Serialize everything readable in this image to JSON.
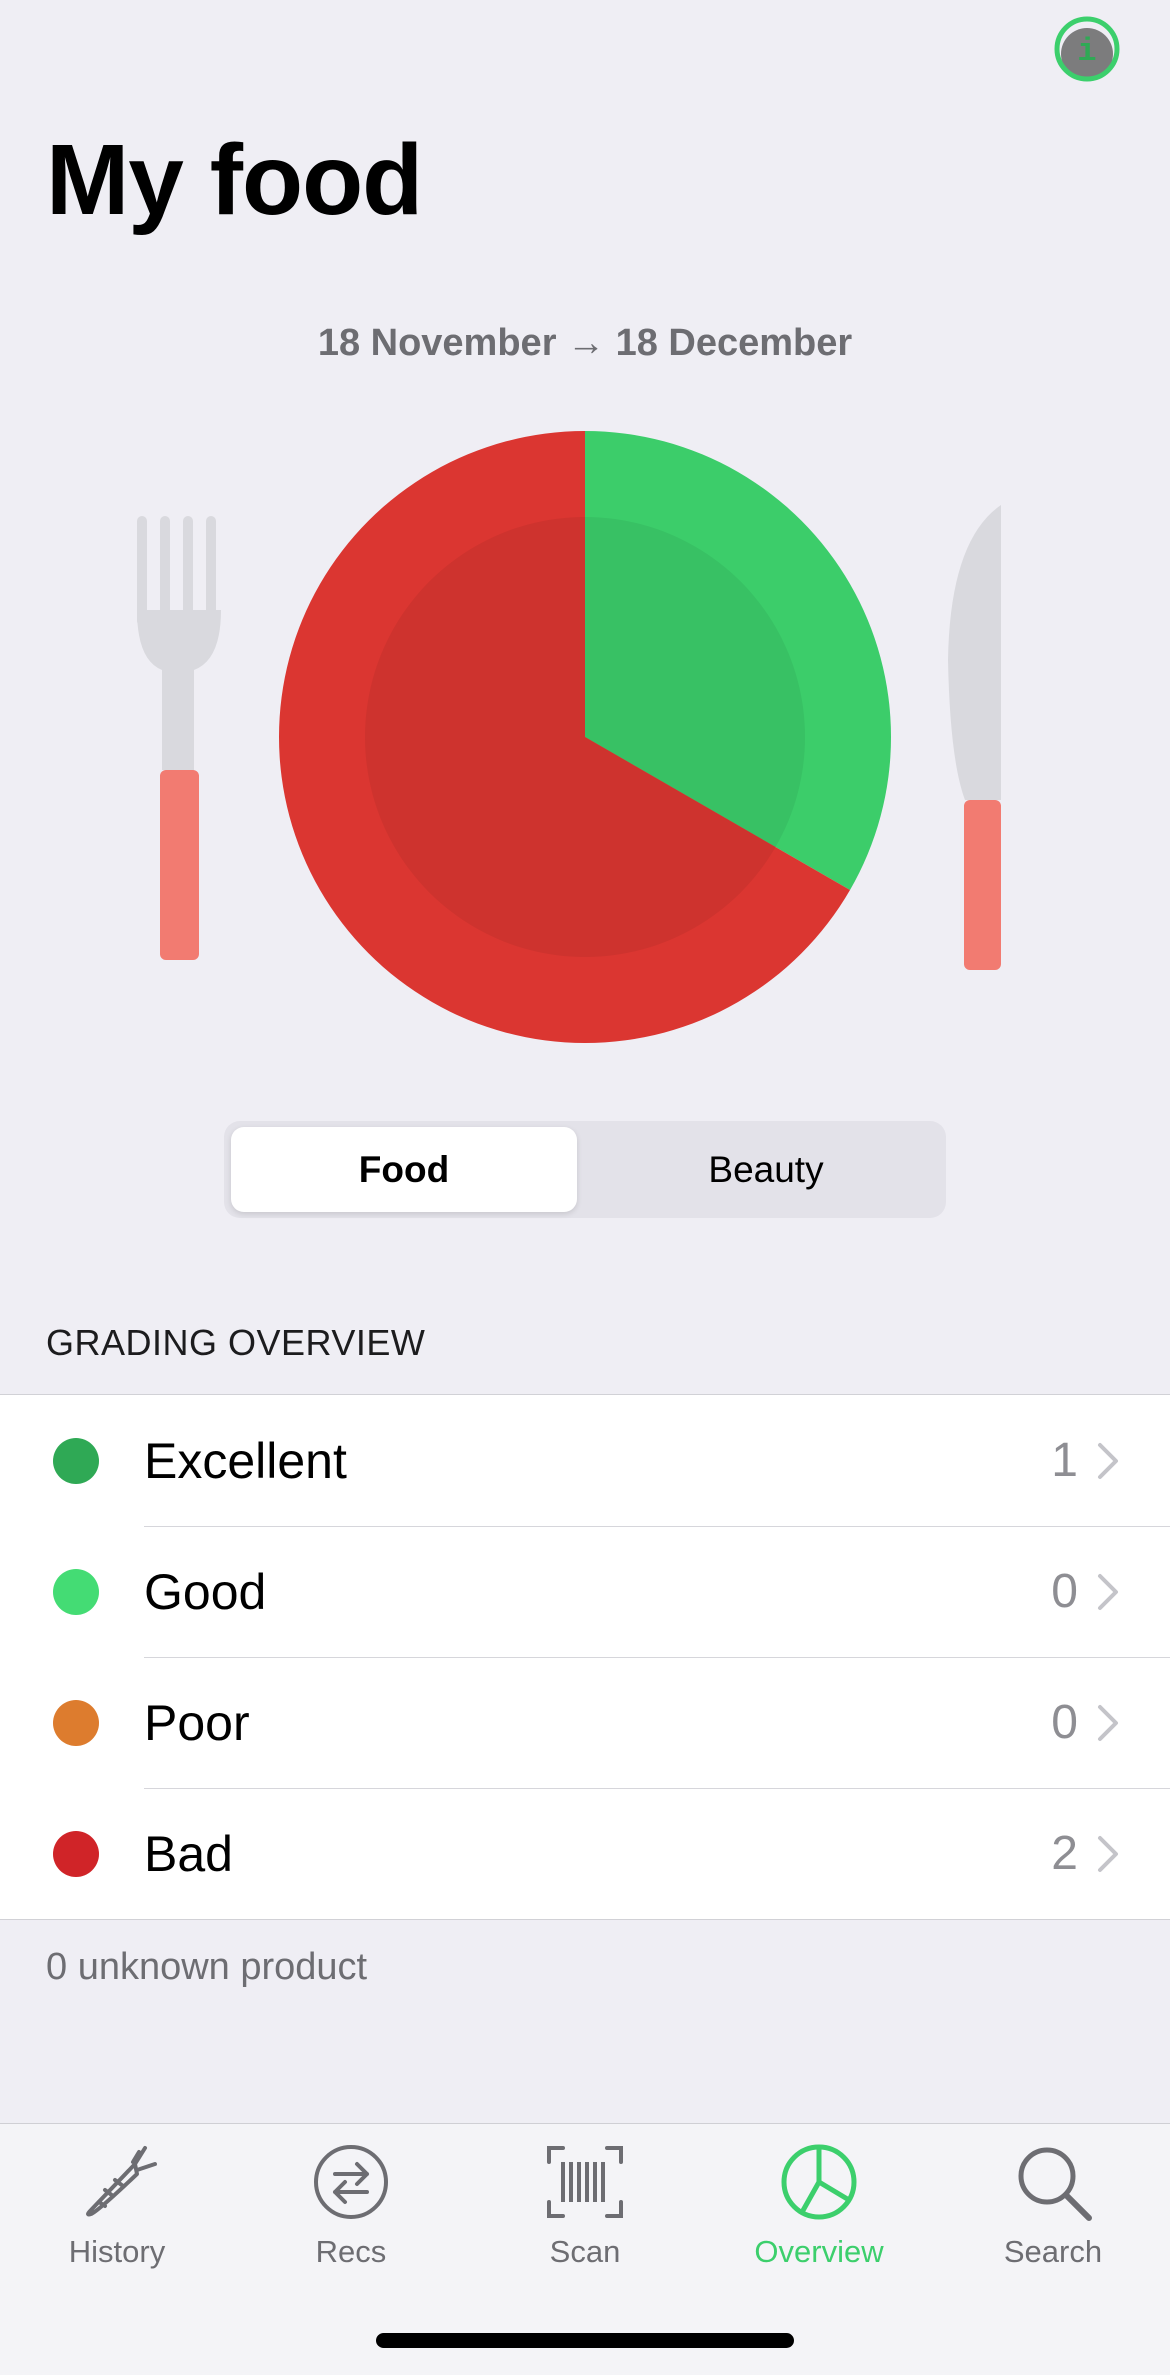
{
  "header": {
    "title": "My food",
    "info_icon": "info-icon"
  },
  "date_range": "18 November → 18 December",
  "chart_data": {
    "type": "pie",
    "title": "",
    "slices": [
      {
        "name": "Excellent",
        "value": 1,
        "color": "#3ccd6a"
      },
      {
        "name": "Bad",
        "value": 2,
        "color": "#db3631"
      }
    ]
  },
  "segmented_control": {
    "options": [
      "Food",
      "Beauty"
    ],
    "selected": "Food"
  },
  "grading": {
    "header": "GRADING OVERVIEW",
    "rows": [
      {
        "label": "Excellent",
        "count": "1",
        "color": "#2fa955"
      },
      {
        "label": "Good",
        "count": "0",
        "color": "#44dc74"
      },
      {
        "label": "Poor",
        "count": "0",
        "color": "#dd7c2e"
      },
      {
        "label": "Bad",
        "count": "2",
        "color": "#d02428"
      }
    ]
  },
  "footer_note": "0 unknown product",
  "tabbar": {
    "items": [
      {
        "label": "History",
        "icon": "carrot-icon"
      },
      {
        "label": "Recs",
        "icon": "swap-arrows-icon"
      },
      {
        "label": "Scan",
        "icon": "barcode-icon"
      },
      {
        "label": "Overview",
        "icon": "pie-chart-icon",
        "active": true
      },
      {
        "label": "Search",
        "icon": "search-icon"
      }
    ]
  }
}
